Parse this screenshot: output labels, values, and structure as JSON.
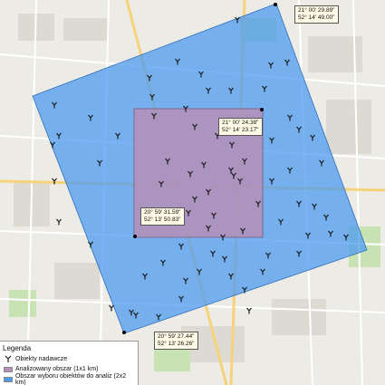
{
  "legend": {
    "title": "Legenda",
    "items": [
      {
        "label": "Obiekty nadawcze",
        "icon": "antenna-icon"
      },
      {
        "label": "Analizowany obszar (1x1 km)",
        "color": "#b58fb6"
      },
      {
        "label": "Obszar wyboru obiektów do analiz (2x2 km)",
        "color": "#4d9bf0"
      }
    ]
  },
  "corners": {
    "outer_top": {
      "lon": "21° 00' 29.89\"",
      "lat": "52° 14' 49.00\""
    },
    "inner_top": {
      "lon": "21° 00' 24.38\"",
      "lat": "52° 14' 23.17\""
    },
    "inner_bottom": {
      "lon": "20° 59' 31.59\"",
      "lat": "52° 13' 50.83\""
    },
    "outer_bottom": {
      "lon": "20° 59' 27.44\"",
      "lat": "52° 13' 26.26\""
    }
  },
  "colors": {
    "outer_area": "#4d9bf0",
    "inner_area": "#b58fb6",
    "basemap": "#ecebe6"
  }
}
